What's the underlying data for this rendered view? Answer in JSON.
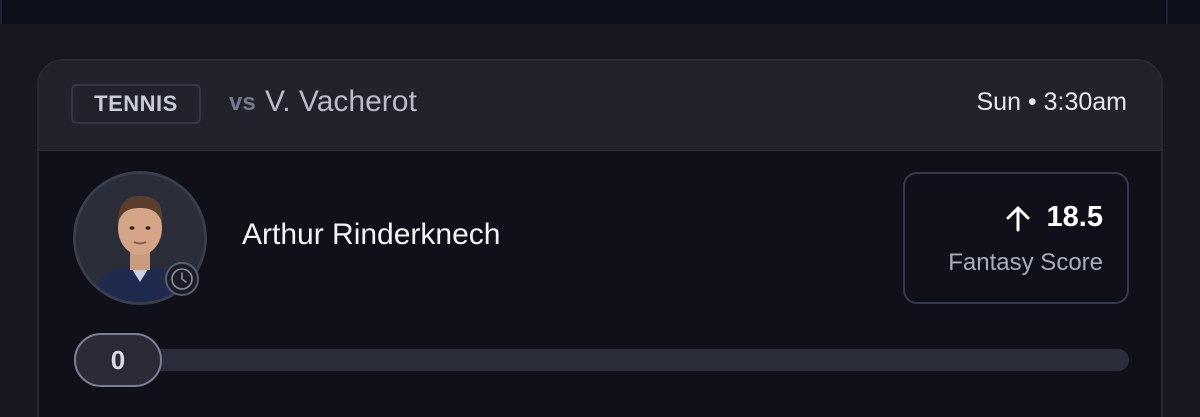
{
  "card": {
    "sport": "TENNIS",
    "vs_prefix": "vs",
    "opponent": "V. Vacherot",
    "game_time": "Sun • 3:30am"
  },
  "player": {
    "name": "Arthur Rinderknech",
    "avatar_icon": "player-headshot",
    "status_icon": "clock-icon"
  },
  "projection": {
    "direction_icon": "arrow-up-icon",
    "value": "18.5",
    "label": "Fantasy Score"
  },
  "progress": {
    "current": "0",
    "fill_fraction": 0
  },
  "colors": {
    "card_header": "#21222c",
    "card_body": "#0f1019",
    "accent_text": "#ffffff",
    "muted_text": "#a9adbb"
  }
}
